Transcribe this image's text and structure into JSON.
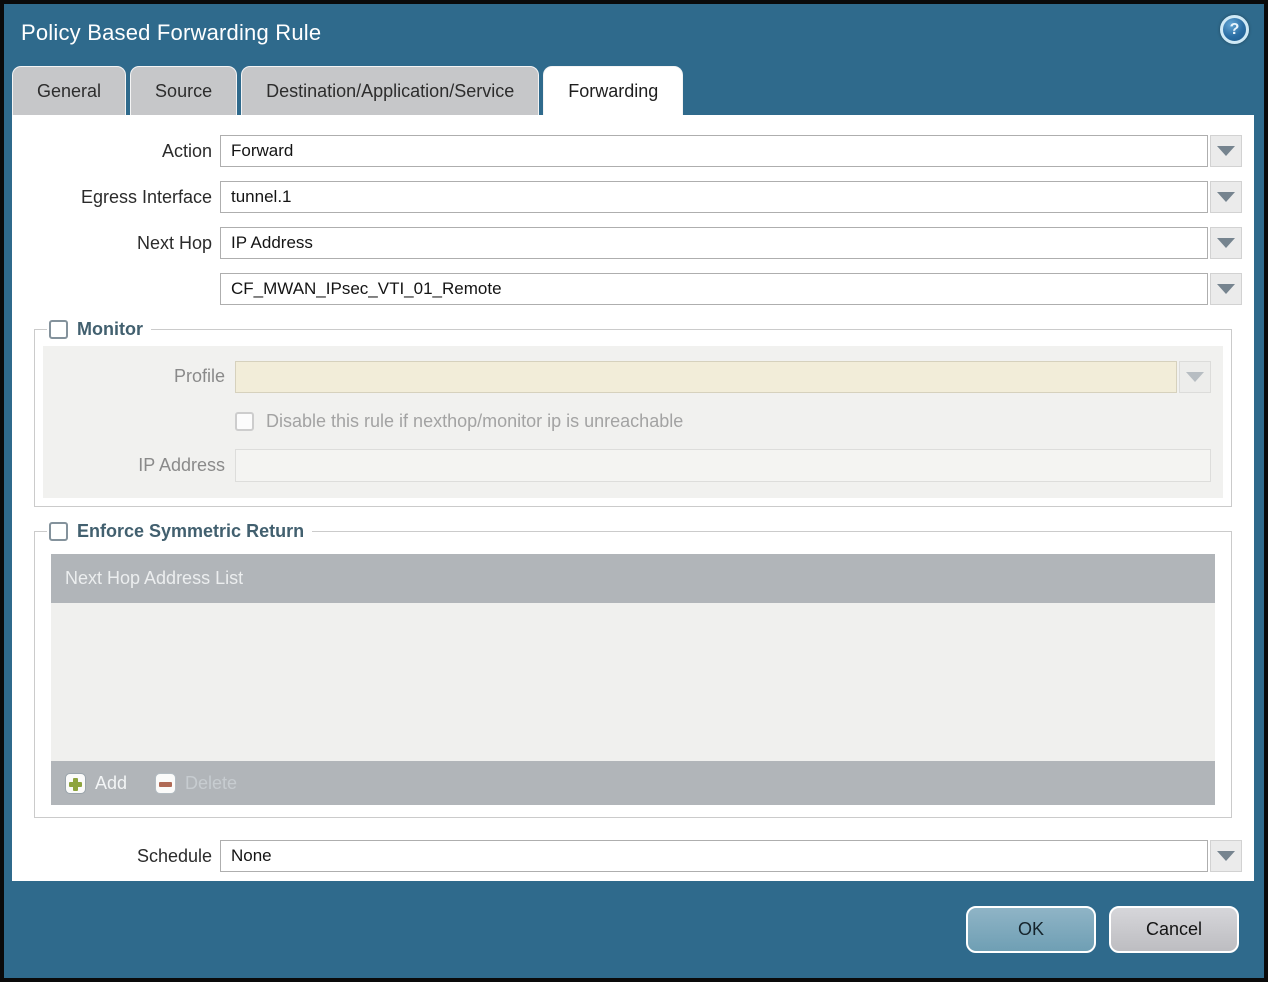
{
  "dialog": {
    "title": "Policy Based Forwarding Rule",
    "help_glyph": "?"
  },
  "tabs": [
    {
      "label": "General",
      "active": false
    },
    {
      "label": "Source",
      "active": false
    },
    {
      "label": "Destination/Application/Service",
      "active": false
    },
    {
      "label": "Forwarding",
      "active": true
    }
  ],
  "form": {
    "action": {
      "label": "Action",
      "value": "Forward"
    },
    "egress_interface": {
      "label": "Egress Interface",
      "value": "tunnel.1"
    },
    "next_hop": {
      "label": "Next Hop",
      "value": "IP Address"
    },
    "next_hop_address": {
      "value": "CF_MWAN_IPsec_VTI_01_Remote"
    },
    "schedule": {
      "label": "Schedule",
      "value": "None"
    }
  },
  "monitor": {
    "title": "Monitor",
    "checked": false,
    "profile": {
      "label": "Profile",
      "value": ""
    },
    "disable_rule": {
      "label": "Disable this rule if nexthop/monitor ip is unreachable",
      "checked": false
    },
    "ip_address": {
      "label": "IP Address",
      "value": ""
    }
  },
  "symmetric_return": {
    "title": "Enforce Symmetric Return",
    "checked": false,
    "table": {
      "header": "Next Hop Address List",
      "rows": []
    },
    "toolbar": {
      "add_label": "Add",
      "delete_label": "Delete"
    }
  },
  "footer": {
    "ok_label": "OK",
    "cancel_label": "Cancel"
  },
  "colors": {
    "titlebar": "#2f6a8c",
    "ok_button": "#7ca9be",
    "table_header": "#b1b5b9",
    "disabled_field": "#f2edd9"
  }
}
